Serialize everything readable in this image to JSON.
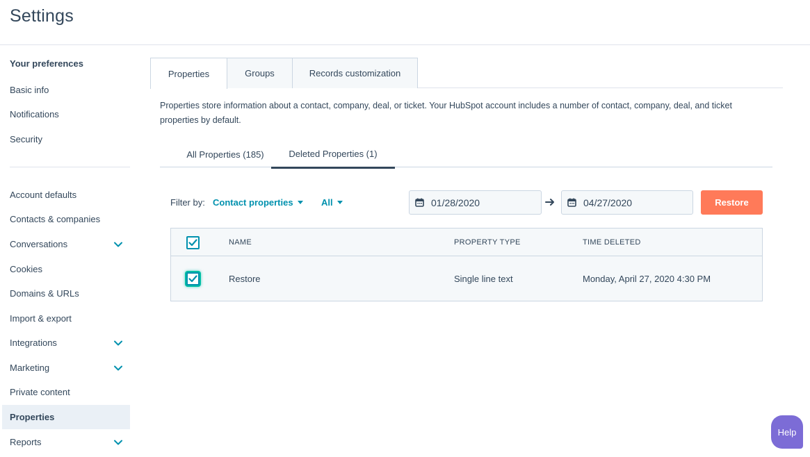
{
  "header": {
    "title": "Settings"
  },
  "sidebar": {
    "heading": "Your preferences",
    "preferences": [
      {
        "label": "Basic info"
      },
      {
        "label": "Notifications"
      },
      {
        "label": "Security"
      }
    ],
    "items": [
      {
        "label": "Account defaults",
        "expandable": false
      },
      {
        "label": "Contacts & companies",
        "expandable": false
      },
      {
        "label": "Conversations",
        "expandable": true
      },
      {
        "label": "Cookies",
        "expandable": false
      },
      {
        "label": "Domains & URLs",
        "expandable": false
      },
      {
        "label": "Import & export",
        "expandable": false
      },
      {
        "label": "Integrations",
        "expandable": true
      },
      {
        "label": "Marketing",
        "expandable": true
      },
      {
        "label": "Private content",
        "expandable": false
      },
      {
        "label": "Properties",
        "expandable": false,
        "active": true
      },
      {
        "label": "Reports",
        "expandable": true
      }
    ]
  },
  "tabs": [
    {
      "label": "Properties",
      "active": true
    },
    {
      "label": "Groups",
      "active": false
    },
    {
      "label": "Records customization",
      "active": false
    }
  ],
  "description": "Properties store information about a contact, company, deal, or ticket. Your HubSpot account includes a number of contact, company, deal, and ticket properties by default.",
  "subtabs": [
    {
      "label": "All Properties (185)",
      "active": false
    },
    {
      "label": "Deleted Properties (1)",
      "active": true
    }
  ],
  "filter": {
    "label": "Filter by:",
    "object_type": "Contact properties",
    "group": "All",
    "start_date": "01/28/2020",
    "end_date": "04/27/2020"
  },
  "restore_button": "Restore",
  "table": {
    "columns": [
      "NAME",
      "PROPERTY TYPE",
      "TIME DELETED"
    ],
    "header_checked": true,
    "rows": [
      {
        "checked": true,
        "name": "Restore",
        "type": "Single line text",
        "time_deleted": "Monday, April 27, 2020 4:30 PM"
      }
    ]
  },
  "help_button": "Help",
  "colors": {
    "accent": "#0091ae",
    "restore": "#ff7a59",
    "help": "#7c6cd6",
    "text": "#33475b",
    "active_bg": "#eaf0f6"
  }
}
